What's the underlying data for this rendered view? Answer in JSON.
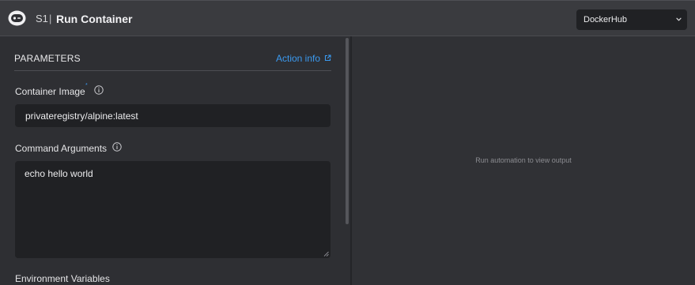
{
  "header": {
    "step": "S1",
    "separator": "|",
    "title": "Run Container",
    "registry_select": {
      "value": "DockerHub"
    }
  },
  "parameters": {
    "section_title": "PARAMETERS",
    "action_info_link": "Action info",
    "required_marker": "*",
    "fields": {
      "container_image": {
        "label": "Container Image",
        "value": "privateregistry/alpine:latest"
      },
      "command_arguments": {
        "label": "Command Arguments",
        "value": "echo hello world"
      },
      "environment_variables": {
        "label": "Environment Variables"
      }
    }
  },
  "output": {
    "placeholder": "Run automation to view output"
  },
  "icons": {
    "app": "robot-logo-icon",
    "info": "info-circle-icon",
    "external": "external-link-icon",
    "chevron": "chevron-down-icon"
  },
  "colors": {
    "accent": "#3b9af0",
    "background": "#2e2f33",
    "header": "#3a3b3f",
    "input": "#202124"
  }
}
